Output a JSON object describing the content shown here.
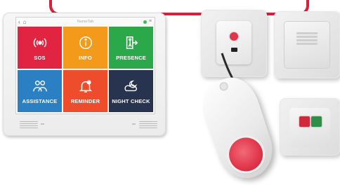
{
  "device": {
    "app_title": "NurseTab",
    "tiles": [
      {
        "label": "SOS",
        "icon": "alarm-icon",
        "color": "#e02442"
      },
      {
        "label": "INFO",
        "icon": "info-icon",
        "color": "#f39a1b"
      },
      {
        "label": "PRESENCE",
        "icon": "door-enter-icon",
        "color": "#2ba84a"
      },
      {
        "label": "ASSISTANCE",
        "icon": "people-icon",
        "color": "#2b7fc3"
      },
      {
        "label": "REMINDER",
        "icon": "bell-icon",
        "color": "#ee4d2c"
      },
      {
        "label": "NIGHT CHECK",
        "icon": "moon-cloud-icon",
        "color": "#28334f"
      }
    ],
    "status_color": "#3cbf4a"
  },
  "accent_color": "#d81f3c"
}
